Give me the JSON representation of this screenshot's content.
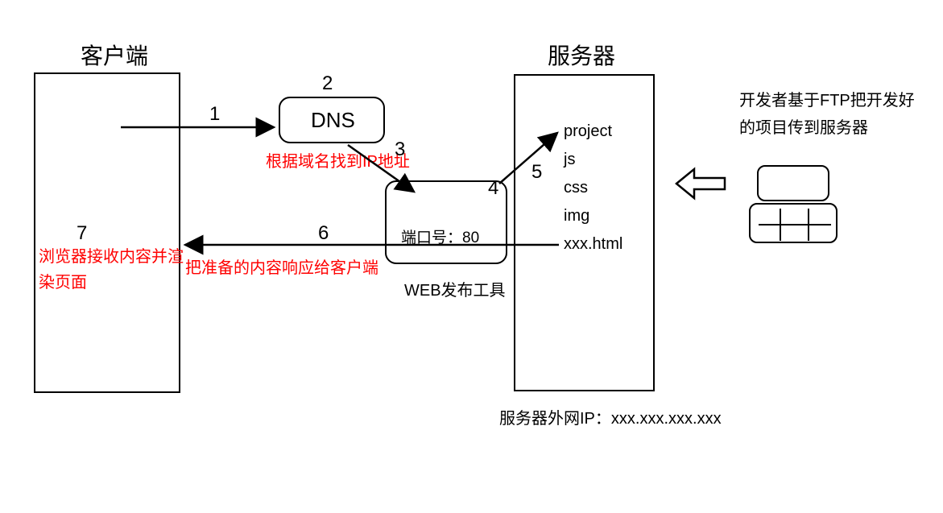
{
  "client": {
    "title": "客户端"
  },
  "server": {
    "title": "服务器",
    "files": [
      "project",
      "js",
      "css",
      "img",
      "xxx.html"
    ],
    "ip_label": "服务器外网IP：xxx.xxx.xxx.xxx"
  },
  "dns": {
    "label": "DNS",
    "note": "根据域名找到IP地址"
  },
  "webtool": {
    "port_label": "端口号：80",
    "title": "WEB发布工具"
  },
  "steps": {
    "s1": "1",
    "s2": "2",
    "s3": "3",
    "s4": "4",
    "s5": "5",
    "s6": "6",
    "s7": "7"
  },
  "notes": {
    "render": "浏览器接收内容并渲染页面",
    "response": "把准备的内容响应给客户端",
    "ftp": "开发者基于FTP把开发好的项目传到服务器"
  }
}
